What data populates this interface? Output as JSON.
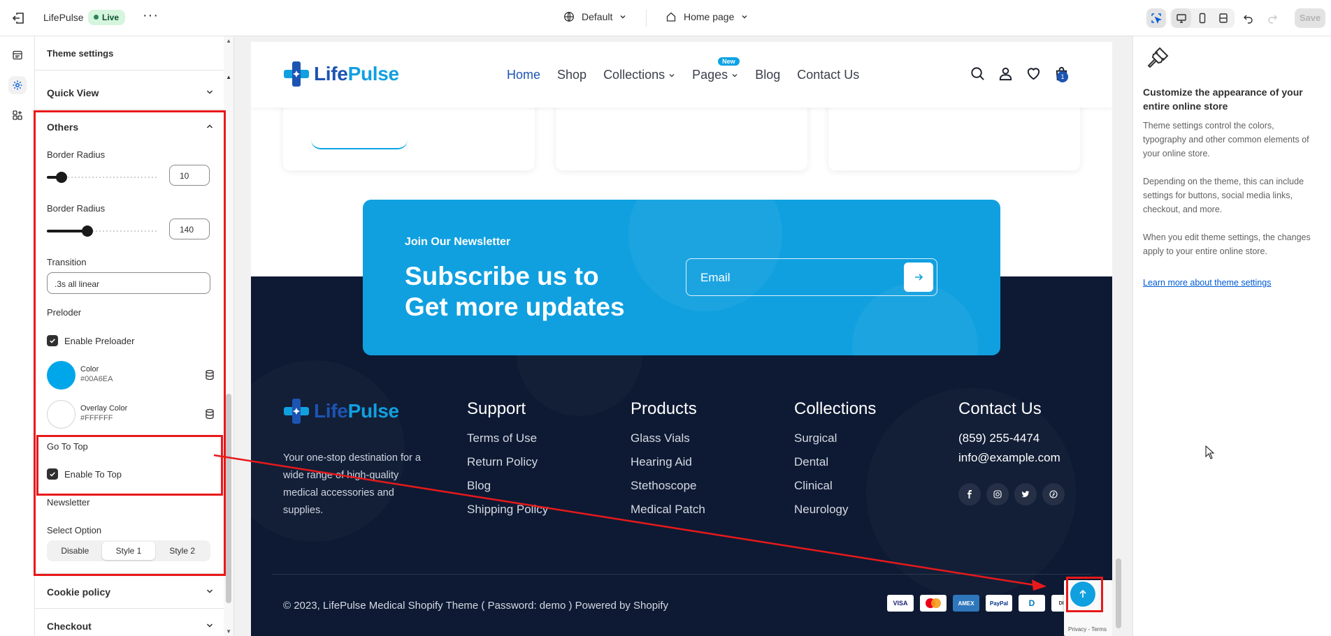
{
  "topbar": {
    "store_name": "LifePulse",
    "status": "Live",
    "more": "···",
    "theme": "Default",
    "page": "Home page",
    "save": "Save"
  },
  "panel": {
    "title": "Theme settings",
    "quick_view": "Quick View",
    "others": "Others",
    "border_radius_1": {
      "label": "Border Radius",
      "value": "10",
      "level": 0.13
    },
    "border_radius_2": {
      "label": "Border Radius",
      "value": "140",
      "level": 0.37
    },
    "transition": {
      "label": "Transition",
      "value": ".3s all linear"
    },
    "preloader": "Preloder",
    "enable_preloader": "Enable Preloader",
    "color": {
      "name": "Color",
      "hex": "#00A6EA"
    },
    "overlay_color": {
      "name": "Overlay Color",
      "hex": "#FFFFFF"
    },
    "go_to_top": "Go To Top",
    "enable_to_top": "Enable To Top",
    "newsletter": "Newsletter",
    "select_option": "Select Option",
    "options": [
      "Disable",
      "Style 1",
      "Style 2"
    ],
    "selected_option": "Style 1",
    "cookie_policy": "Cookie policy",
    "checkout": "Checkout"
  },
  "preview": {
    "logo": {
      "part1": "Life",
      "part2": "Pulse"
    },
    "nav": [
      "Home",
      "Shop",
      "Collections",
      "Pages",
      "Blog",
      "Contact Us"
    ],
    "new_badge": "New",
    "cart_count": "1",
    "newsletter": {
      "kicker": "Join Our Newsletter",
      "line1": "Subscribe us to",
      "line2": "Get more updates",
      "placeholder": "Email"
    },
    "about": "Your one-stop destination for a wide range of high-quality medical accessories and supplies.",
    "columns": [
      {
        "title": "Support",
        "links": [
          "Terms of Use",
          "Return Policy",
          "Blog",
          "Shipping Policy"
        ]
      },
      {
        "title": "Products",
        "links": [
          "Glass Vials",
          "Hearing Aid",
          "Stethoscope",
          "Medical Patch"
        ]
      },
      {
        "title": "Collections",
        "links": [
          "Surgical",
          "Dental",
          "Clinical",
          "Neurology"
        ]
      },
      {
        "title": "Contact Us",
        "links": [
          "(859) 255-4474",
          "info@example.com"
        ]
      }
    ],
    "copyright": "© 2023, LifePulse Medical Shopify Theme ( Password: demo ) Powered by Shopify",
    "payments": [
      "VISA",
      "MC",
      "AMEX",
      "PayPal",
      "D",
      "DISC"
    ],
    "recaptcha": "Privacy - Terms"
  },
  "info": {
    "heading": "Customize the appearance of your entire online store",
    "p1": "Theme settings control the colors, typography and other common elements of your online store.",
    "p2": "Depending on the theme, this can include settings for buttons, social media links, checkout, and more.",
    "p3": "When you edit theme settings, the changes apply to your entire online store.",
    "link": "Learn more about theme settings"
  },
  "colors": {
    "accent": "#00A6EA",
    "footer_bg": "#0E1A33",
    "newsletter_bg": "#10A0E0",
    "annotation": "#E8191B",
    "nav_active": "#1C54B2"
  }
}
